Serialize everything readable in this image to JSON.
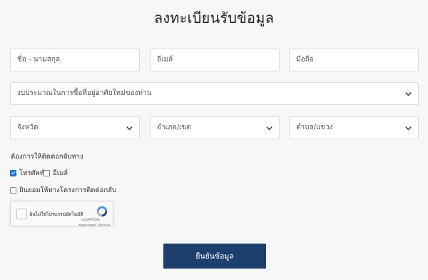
{
  "page": {
    "title": "ลงทะเบียนรับข้อมูล"
  },
  "form": {
    "name_placeholder": "ชื่อ - นามสกุล",
    "email_placeholder": "อีเมล์",
    "phone_placeholder": "มือถือ",
    "budget_select": "งบประมาณในการซื้อที่อยู่อาศัยใหม่ของท่าน",
    "province_select": "จังหวัด",
    "district_select": "อำเภอ/เขต",
    "subdistrict_select": "ตำบล/แขวง",
    "contact_method_label": "ต้องการให้ติดต่อกลับทาง",
    "contact_phone_label": "โทรศัพท์",
    "contact_phone_checked": true,
    "contact_email_label": "อีเมล์",
    "contact_email_checked": false,
    "consent_label": "ยินยอมให้ทางโครงการติดต่อกลับ",
    "consent_checked": false,
    "submit_label": "ยืนยันข้อมูล"
  },
  "recaptcha": {
    "label": "ฉันไม่ใช่โปรแกรมอัตโนมัติ",
    "brand": "reCAPTCHA",
    "terms": "ข้อมูลส่วนบุคคล - ข้อกำหนด",
    "icon": "recaptcha-logo-icon"
  },
  "colors": {
    "background": "#f7f7f7",
    "submit_bg": "#1d3f6e",
    "checkbox_checked": "#1a73e8"
  },
  "icons": {
    "select": "chevron-down-icon"
  }
}
